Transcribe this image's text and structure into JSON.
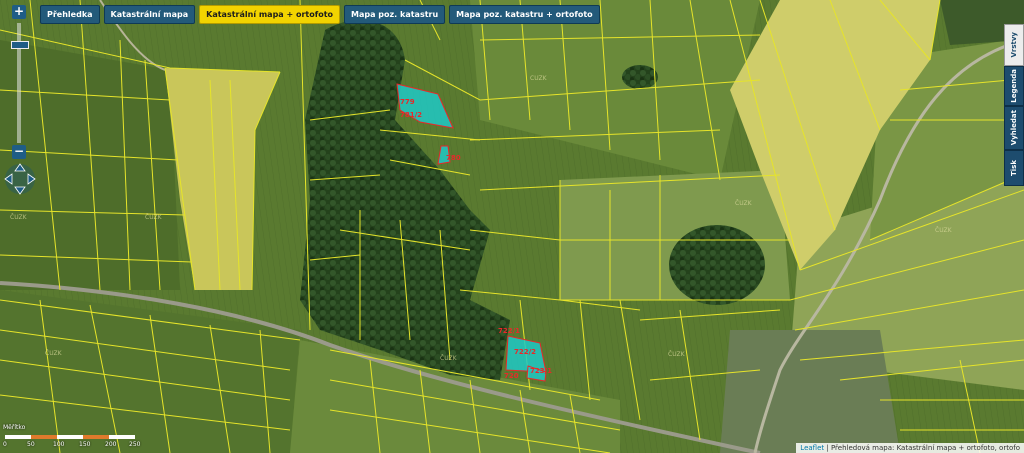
{
  "tabs": [
    {
      "label": "Přehledka",
      "active": false
    },
    {
      "label": "Katastrální mapa",
      "active": false
    },
    {
      "label": "Katastrální mapa + ortofoto",
      "active": true
    },
    {
      "label": "Mapa poz. katastru",
      "active": false
    },
    {
      "label": "Mapa poz. katastru + ortofoto",
      "active": false
    }
  ],
  "zoom": {
    "in": "+",
    "out": "−"
  },
  "side_tabs": [
    {
      "label": "Vrstvy"
    },
    {
      "label": "Legenda"
    },
    {
      "label": "Vyhledat"
    },
    {
      "label": "Tisk"
    }
  ],
  "parcels": [
    {
      "label": "779"
    },
    {
      "label": "781/2"
    },
    {
      "label": "780"
    },
    {
      "label": "722/1"
    },
    {
      "label": "722/2"
    },
    {
      "label": "723/1"
    },
    {
      "label": "720"
    }
  ],
  "district_labels": [
    "ČUZK",
    "ČUZK",
    "ČUZK",
    "ČUZK",
    "ČUZK",
    "ČUZK",
    "ČUZK",
    "ČUZK"
  ],
  "scale": {
    "title": "Měřítko",
    "ticks": [
      "0",
      "50",
      "100",
      "150",
      "200",
      "250"
    ]
  },
  "attribution": {
    "link": "Leaflet",
    "text": "| Přehledová mapa: Katastrální mapa + ortofoto, ortofo"
  },
  "colors": {
    "parcel_lines": "#e6e42a",
    "selected_parcel": "#1fc9c6",
    "parcel_label": "#e8282a",
    "active_tab": "#f2d300",
    "tab": "#235a7a",
    "rapeseed_field": "#c9c65a"
  }
}
